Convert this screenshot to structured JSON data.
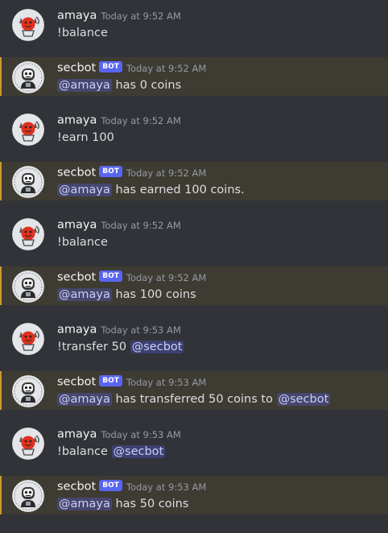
{
  "messages": [
    {
      "author": "amaya",
      "bot": false,
      "time": "Today at 9:52 AM",
      "parts": [
        {
          "text": "!balance"
        }
      ]
    },
    {
      "author": "secbot",
      "bot": true,
      "bot_tag": "BOT",
      "time": "Today at 9:52 AM",
      "parts": [
        {
          "mention": "@amaya"
        },
        {
          "text": " has 0 coins"
        }
      ]
    },
    {
      "author": "amaya",
      "bot": false,
      "time": "Today at 9:52 AM",
      "parts": [
        {
          "text": "!earn 100"
        }
      ]
    },
    {
      "author": "secbot",
      "bot": true,
      "bot_tag": "BOT",
      "time": "Today at 9:52 AM",
      "parts": [
        {
          "mention": "@amaya"
        },
        {
          "text": " has earned 100 coins."
        }
      ]
    },
    {
      "author": "amaya",
      "bot": false,
      "time": "Today at 9:52 AM",
      "parts": [
        {
          "text": "!balance"
        }
      ]
    },
    {
      "author": "secbot",
      "bot": true,
      "bot_tag": "BOT",
      "time": "Today at 9:52 AM",
      "parts": [
        {
          "mention": "@amaya"
        },
        {
          "text": " has 100 coins"
        }
      ]
    },
    {
      "author": "amaya",
      "bot": false,
      "time": "Today at 9:53 AM",
      "parts": [
        {
          "text": "!transfer 50 "
        },
        {
          "mention": "@secbot"
        }
      ]
    },
    {
      "author": "secbot",
      "bot": true,
      "bot_tag": "BOT",
      "time": "Today at 9:53 AM",
      "parts": [
        {
          "mention": "@amaya"
        },
        {
          "text": " has transferred 50 coins to "
        },
        {
          "mention": "@secbot"
        }
      ]
    },
    {
      "author": "amaya",
      "bot": false,
      "time": "Today at 9:53 AM",
      "parts": [
        {
          "text": "!balance "
        },
        {
          "mention": "@secbot"
        }
      ]
    },
    {
      "author": "secbot",
      "bot": true,
      "bot_tag": "BOT",
      "time": "Today at 9:53 AM",
      "parts": [
        {
          "mention": "@amaya"
        },
        {
          "text": " has 50 coins"
        }
      ]
    }
  ],
  "colors": {
    "background": "#313338",
    "highlight_background": "#3e3b33",
    "highlight_border": "#c89a2d",
    "bot_tag": "#5865f2",
    "mention_text": "#c9cdfb"
  },
  "icons": {
    "user_avatar": "cat-avatar-icon",
    "bot_avatar": "robot-avatar-icon"
  }
}
